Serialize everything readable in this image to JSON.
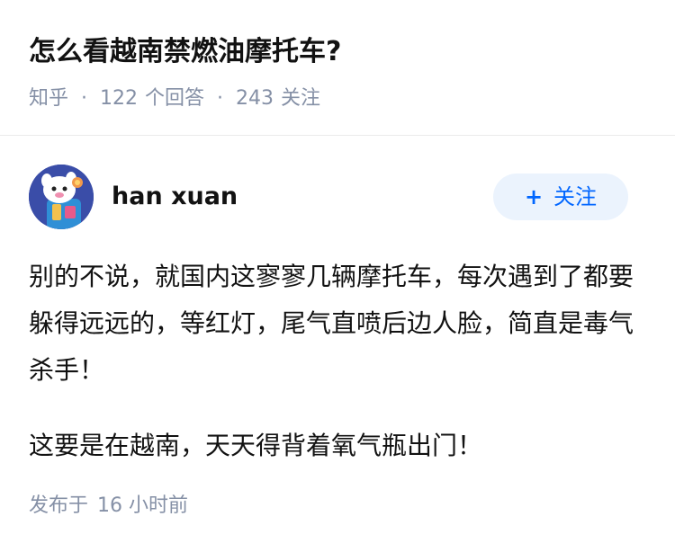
{
  "question": {
    "title": "怎么看越南禁燃油摩托车?",
    "source": "知乎",
    "answers_count": "122",
    "answers_label": "个回答",
    "followers_count": "243",
    "followers_label": "关注"
  },
  "answer": {
    "author": {
      "name": "han xuan",
      "follow_label": "关注"
    },
    "paragraphs": [
      "别的不说，就国内这寥寥几辆摩托车，每次遇到了都要躲得远远的，等红灯，尾气直喷后边人脸，简直是毒气杀手！",
      "这要是在越南，天天得背着氧气瓶出门！"
    ],
    "post_time_label": "发布于",
    "post_time_value": "16 小时前"
  },
  "icons": {
    "follow": "plus-icon",
    "avatar": "cartoon-avatar"
  },
  "colors": {
    "primary_text": "#121212",
    "secondary_text": "#8590a6",
    "accent": "#0066ff",
    "follow_bg": "#ebf3fd",
    "avatar_bg": "#3a4da8"
  }
}
